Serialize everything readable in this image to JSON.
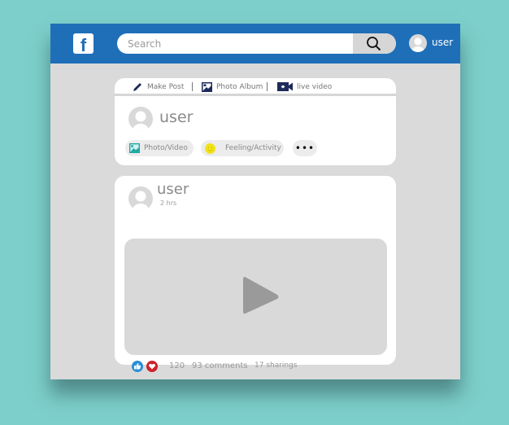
{
  "topbar": {
    "logo": "f",
    "search_placeholder": "Search",
    "search_icon": "search-icon",
    "user_label": "user"
  },
  "composer": {
    "tabs": [
      {
        "label": "Make Post",
        "icon": "pencil-icon"
      },
      {
        "label": "Photo Album",
        "icon": "photo-album-icon"
      },
      {
        "label": "live video",
        "icon": "video-camera-icon"
      }
    ],
    "user_name": "user",
    "actions": [
      {
        "label": "Photo/Video",
        "icon": "image-icon"
      },
      {
        "label": "Feeling/Activity",
        "icon": "smiley-icon"
      },
      {
        "label": "•••",
        "icon": "more-icon"
      }
    ]
  },
  "post": {
    "user_name": "user",
    "time": "2 hrs",
    "media": "video",
    "reaction_icons": [
      "like-icon",
      "love-icon"
    ],
    "reactions_count": "120",
    "comments": "93 comments",
    "shares": "17 sharings"
  },
  "colors": {
    "background": "#7dcfcb",
    "brand": "#1f6fb8",
    "window": "#dadada",
    "like": "#2a8fd6",
    "love": "#d0202a",
    "feeling": "#f2e21b",
    "photo": "#1aa5a0",
    "tab_icons": "#1e2a5a"
  }
}
